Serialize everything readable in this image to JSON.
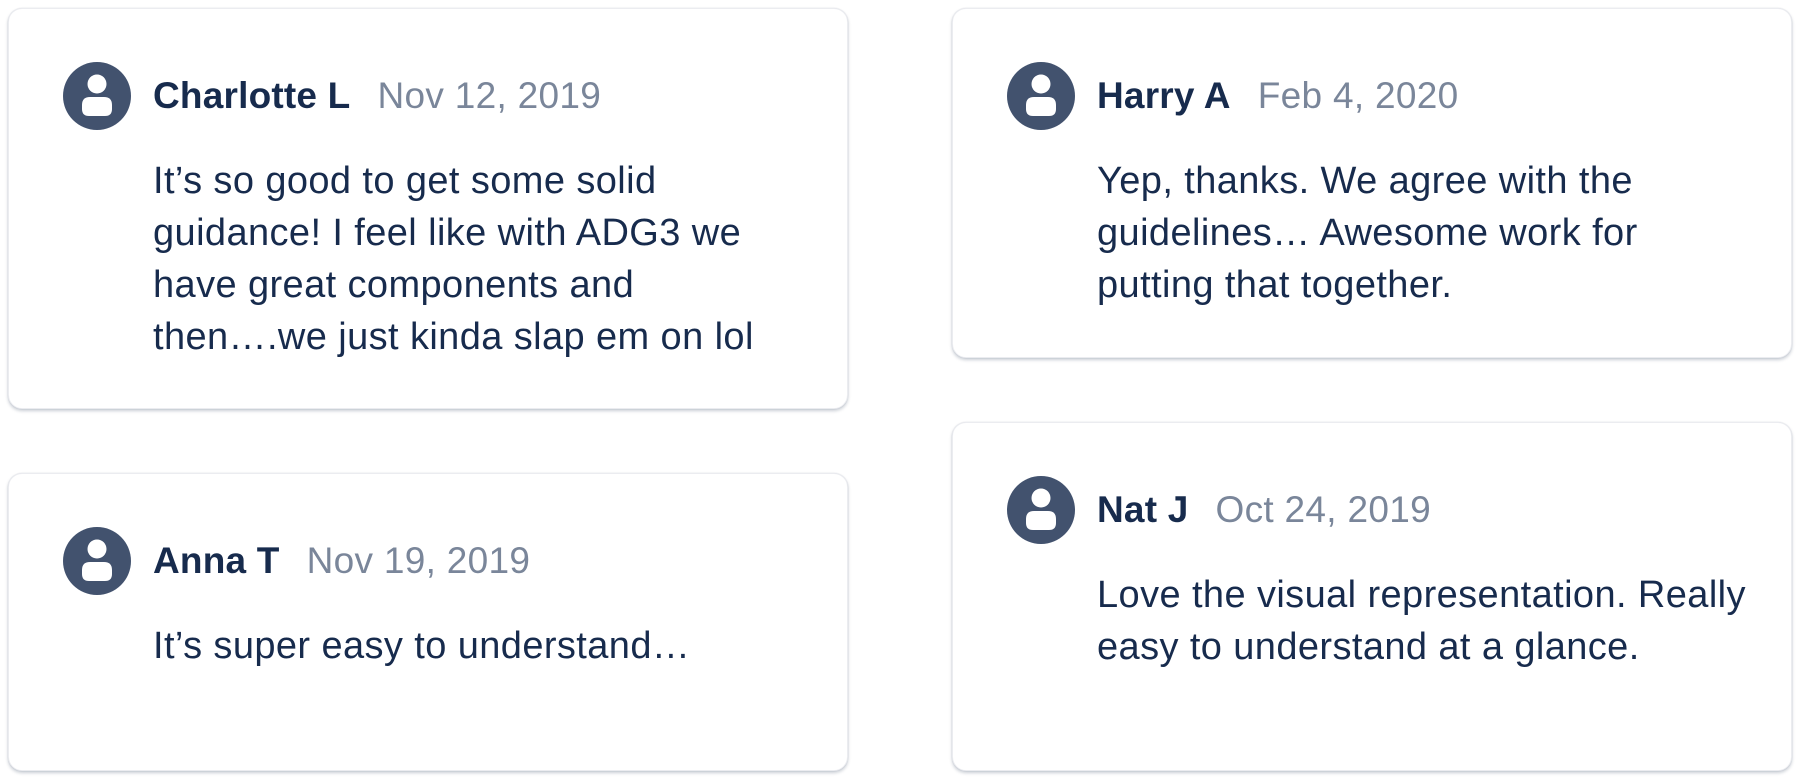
{
  "colors": {
    "author_text": "#172b4d",
    "date_text": "#7a869a",
    "body_text": "#172b4d",
    "avatar_fill": "#42526e",
    "card_background": "#ffffff"
  },
  "comments": [
    {
      "avatar_icon": "user-avatar-icon",
      "author": "Charlotte L",
      "date": "Nov 12, 2019",
      "text": "It’s so good to get some solid guidance! I feel like with ADG3 we have great components and then….we just kinda slap em on lol"
    },
    {
      "avatar_icon": "user-avatar-icon",
      "author": "Anna T",
      "date": "Nov 19, 2019",
      "text": "It’s super easy to understand…"
    },
    {
      "avatar_icon": "user-avatar-icon",
      "author": "Harry A",
      "date": "Feb 4, 2020",
      "text": "Yep, thanks. We agree with the guidelines… Awesome work for putting that together."
    },
    {
      "avatar_icon": "user-avatar-icon",
      "author": "Nat J",
      "date": "Oct 24, 2019",
      "text": "Love the visual representation. Really easy to understand at a glance."
    }
  ]
}
